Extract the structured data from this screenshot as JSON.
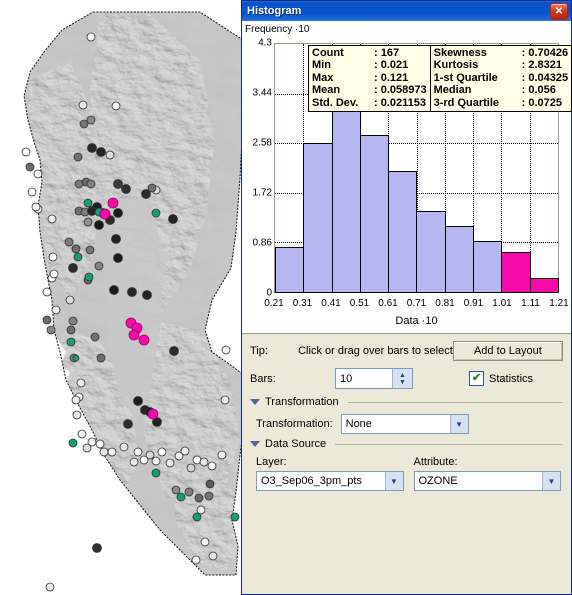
{
  "window": {
    "title": "Histogram",
    "close_label": "✕"
  },
  "chart_data": {
    "type": "bar",
    "title": "Histogram",
    "xlabel": "Data ·10",
    "ylabel": "Frequency ·10",
    "categories": [
      "0.21-0.31",
      "0.31-0.41",
      "0.41-0.51",
      "0.51-0.61",
      "0.61-0.71",
      "0.71-0.81",
      "0.81-0.91",
      "0.91-1.01",
      "1.01-1.11",
      "1.11-1.21"
    ],
    "values": [
      0.78,
      2.58,
      3.87,
      2.72,
      2.09,
      1.41,
      1.15,
      0.89,
      0.69,
      0.25
    ],
    "bar_states": [
      "normal",
      "normal",
      "normal",
      "normal",
      "normal",
      "normal",
      "normal",
      "normal",
      "selected",
      "selected"
    ],
    "ylim": [
      0,
      4.3
    ],
    "xlim": [
      0.21,
      1.21
    ],
    "yticks": [
      "0",
      "0.86",
      "1.72",
      "2.58",
      "3.44",
      "4.3"
    ],
    "ytick_values": [
      0,
      0.86,
      1.72,
      2.58,
      3.44,
      4.3
    ],
    "xticks": [
      "0.21",
      "0.31",
      "0.41",
      "0.51",
      "0.61",
      "0.71",
      "0.81",
      "0.91",
      "1.01",
      "1.11",
      "1.21"
    ],
    "xtick_values": [
      0.21,
      0.31,
      0.41,
      0.51,
      0.61,
      0.71,
      0.81,
      0.91,
      1.01,
      1.11,
      1.21
    ],
    "grid": true,
    "legend": "none",
    "colors": {
      "bar": "#B6B6F0",
      "bar_selected": "#F50CA8",
      "bar_outline": "#000000"
    }
  },
  "statistics": {
    "left": [
      {
        "key": "Count",
        "sep": ":",
        "value": "167"
      },
      {
        "key": "Min",
        "sep": ":",
        "value": "0.021"
      },
      {
        "key": "Max",
        "sep": ":",
        "value": "0.121"
      },
      {
        "key": "Mean",
        "sep": ":",
        "value": "0.058973"
      },
      {
        "key": "Std. Dev.",
        "sep": ":",
        "value": "0.021153"
      }
    ],
    "right": [
      {
        "key": "Skewness",
        "sep": ":",
        "value": "0.70426"
      },
      {
        "key": "Kurtosis",
        "sep": ":",
        "value": "2.8321"
      },
      {
        "key": "1-st Quartile",
        "sep": ":",
        "value": "0.04325"
      },
      {
        "key": "Median",
        "sep": ":",
        "value": "0.056"
      },
      {
        "key": "3-rd Quartile",
        "sep": ":",
        "value": "0.0725"
      }
    ]
  },
  "controls": {
    "tip_label": "Tip:",
    "tip_text": "Click or drag over bars to select",
    "add_to_layout_label": "Add to Layout",
    "bars_label": "Bars:",
    "bars_value": "10",
    "statistics_label": "Statistics",
    "statistics_checked": "✔"
  },
  "transformation": {
    "group_label": "Transformation",
    "field_label": "Transformation:",
    "value": "None"
  },
  "data_source": {
    "group_label": "Data Source",
    "layer_label": "Layer:",
    "layer_value": "O3_Sep06_3pm_pts",
    "attribute_label": "Attribute:",
    "attribute_value": "OZONE"
  },
  "map": {
    "description": "California shaded-relief map with ozone monitoring station points",
    "point_colors": {
      "selected": "#F50CA8",
      "dark": "#2B2B2B",
      "mid": "#6E6E6E",
      "light": "#FFFFFF",
      "teal": "#12A07A"
    }
  }
}
